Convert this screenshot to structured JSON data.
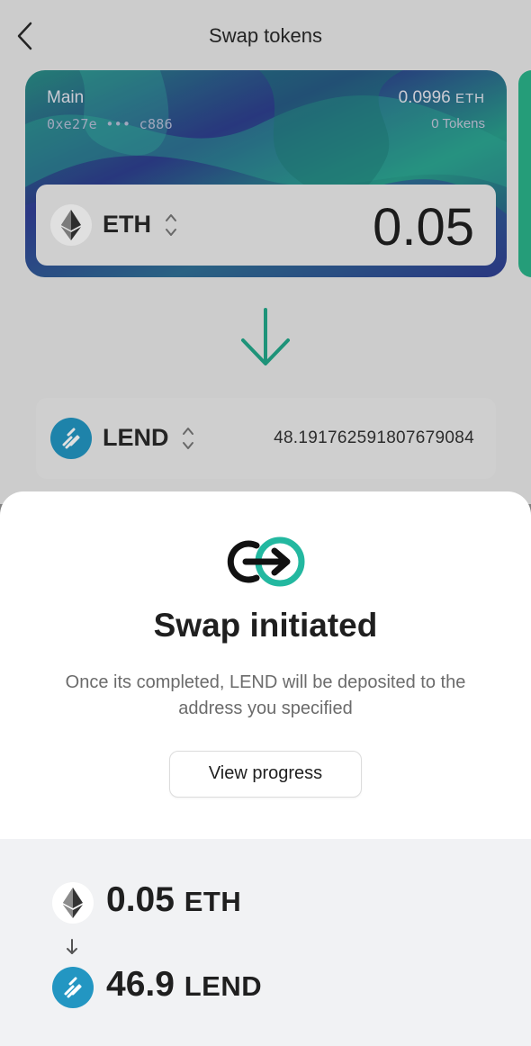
{
  "header": {
    "title": "Swap tokens"
  },
  "wallet": {
    "name": "Main",
    "address": "0xe27e ••• c886",
    "balance_value": "0.0996",
    "balance_unit": "ETH",
    "tokens": "0 Tokens"
  },
  "from": {
    "token": "ETH",
    "amount": "0.05"
  },
  "to": {
    "token": "LEND",
    "amount": "48.191762591807679084"
  },
  "sheet": {
    "title": "Swap initiated",
    "description": "Once its completed, LEND will be deposited to the address you specified",
    "button_label": "View progress"
  },
  "summary": {
    "from_value": "0.05",
    "from_unit": "ETH",
    "to_value": "46.9",
    "to_unit": "LEND"
  },
  "colors": {
    "accent": "#23a88a",
    "lend": "#2396c2"
  },
  "icons": [
    "back-chevron-icon",
    "eth-icon",
    "lend-icon",
    "stepper-icon",
    "down-arrow-icon",
    "swap-link-icon"
  ]
}
